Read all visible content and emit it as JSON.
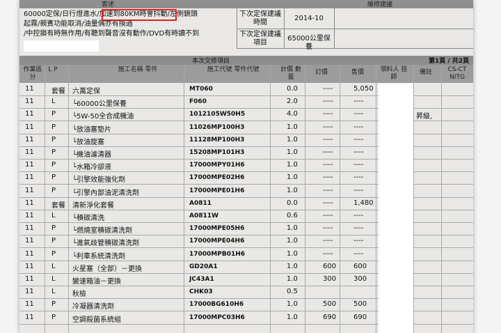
{
  "header": {
    "customer_label": "客述",
    "maintenance_label": "維修建議"
  },
  "notes": {
    "line1_pre": "60000定保/日行燈進水",
    "line1_highlight": "/加速到80KM時會抖動/",
    "line1_post": "左側鏡頭",
    "line2": "起霧/親賓功能取消/油量偶亦有換過",
    "line3": "/中控鎖有時無作用/有聽到聲音沒有動作/DVD有時讀不到"
  },
  "maintenance": {
    "next_time_label": "下次定保建議時間",
    "next_time_value": "2014-10",
    "next_item_label": "下次定保建議項目",
    "next_item_value": "65000公里保養"
  },
  "section": {
    "title": "本次交修項目",
    "page": "第1頁 / 共2頁"
  },
  "columns": {
    "type": "作業區分",
    "lp": "L P",
    "name": "施工名稱 零件",
    "code": "施工代號 零件代號",
    "qty": "計價 數量",
    "order_price": "訂價",
    "sale_price": "售價",
    "tech": "領料人 技師",
    "remark": "備註",
    "csct": "CS-CT NITG"
  },
  "rows": [
    {
      "type": "11",
      "lp": "套餐",
      "name": "六萬定保",
      "code": "MT060",
      "qty": "0.0",
      "order": "----",
      "sale": "5,050",
      "remark": ""
    },
    {
      "type": "11",
      "lp": "L",
      "name": "└60000公里保養",
      "code": "F060",
      "qty": "2.0",
      "order": "----",
      "sale": "----",
      "remark": ""
    },
    {
      "type": "11",
      "lp": "P",
      "name": "└5W-50全合成機油",
      "code": "1012105W50H5",
      "qty": "4.0",
      "order": "----",
      "sale": "----",
      "remark": "昇級,"
    },
    {
      "type": "11",
      "lp": "P",
      "name": "└放油塞墊片",
      "code": "11026MP100H3",
      "qty": "1.0",
      "order": "----",
      "sale": "----",
      "remark": ""
    },
    {
      "type": "11",
      "lp": "P",
      "name": "└放油旋塞",
      "code": "11128MP100H3",
      "qty": "1.0",
      "order": "----",
      "sale": "----",
      "remark": ""
    },
    {
      "type": "11",
      "lp": "P",
      "name": "└機油濾清器",
      "code": "15208MP101H3",
      "qty": "1.0",
      "order": "----",
      "sale": "----",
      "remark": ""
    },
    {
      "type": "11",
      "lp": "P",
      "name": "└水箱冷卻液",
      "code": "17000MPY01H6",
      "qty": "1.0",
      "order": "----",
      "sale": "----",
      "remark": ""
    },
    {
      "type": "11",
      "lp": "P",
      "name": "└引擎效能強化劑",
      "code": "17000MPE02H6",
      "qty": "1.0",
      "order": "----",
      "sale": "----",
      "remark": ""
    },
    {
      "type": "11",
      "lp": "P",
      "name": "└引擎內部油泥清洗劑",
      "code": "17000MPE01H6",
      "qty": "1.0",
      "order": "----",
      "sale": "----",
      "remark": ""
    },
    {
      "type": "11",
      "lp": "套餐",
      "name": "清新淨化套餐",
      "code": "A0811",
      "qty": "0.0",
      "order": "----",
      "sale": "1,480",
      "remark": ""
    },
    {
      "type": "11",
      "lp": "L",
      "name": "└積碳清洗",
      "code": "A0811W",
      "qty": "0.6",
      "order": "----",
      "sale": "----",
      "remark": ""
    },
    {
      "type": "11",
      "lp": "P",
      "name": "└燃燒室積碳清洗劑",
      "code": "17000MPE05H6",
      "qty": "1.0",
      "order": "----",
      "sale": "----",
      "remark": ""
    },
    {
      "type": "11",
      "lp": "P",
      "name": "└進氣歧管積碳清洗劑",
      "code": "17000MPE04H6",
      "qty": "1.0",
      "order": "----",
      "sale": "----",
      "remark": ""
    },
    {
      "type": "11",
      "lp": "P",
      "name": "└利車系統清洗劑",
      "code": "17000MPB01H6",
      "qty": "1.0",
      "order": "----",
      "sale": "----",
      "remark": ""
    },
    {
      "type": "11",
      "lp": "L",
      "name": "火星塞（全部）－更換",
      "code": "GD20A1",
      "qty": "1.0",
      "order": "600",
      "sale": "600",
      "remark": ""
    },
    {
      "type": "11",
      "lp": "L",
      "name": "變速箱油－更換",
      "code": "JC43A1",
      "qty": "1.0",
      "order": "300",
      "sale": "300",
      "remark": ""
    },
    {
      "type": "11",
      "lp": "L",
      "name": "秋檢",
      "code": "CHK03",
      "qty": "0.5",
      "order": "",
      "sale": "",
      "remark": ""
    },
    {
      "type": "11",
      "lp": "P",
      "name": "冷凝器清洗劑",
      "code": "17000BG610H6",
      "qty": "1.0",
      "order": "500",
      "sale": "500",
      "remark": ""
    },
    {
      "type": "11",
      "lp": "P",
      "name": "空調殺菌系統組",
      "code": "17000MPC03H6",
      "qty": "1.0",
      "order": "690",
      "sale": "690",
      "remark": ""
    }
  ]
}
